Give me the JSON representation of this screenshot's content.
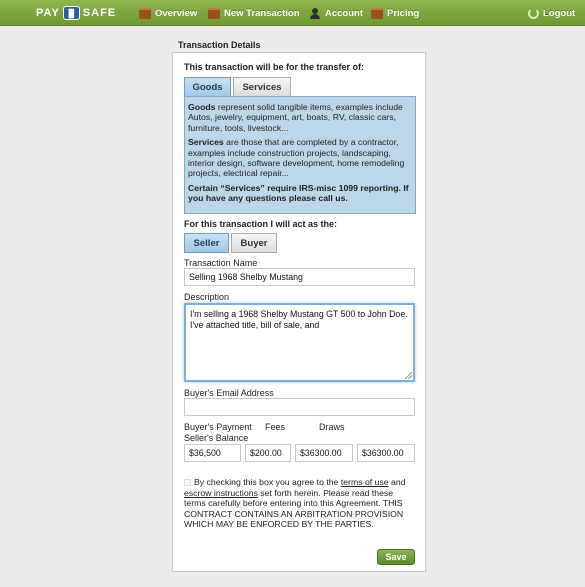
{
  "nav": {
    "logo_left": "PAY",
    "logo_mark": "▐▌",
    "logo_right": "SAFE",
    "items": [
      {
        "label": "Overview"
      },
      {
        "label": "New Transaction"
      },
      {
        "label": "Account"
      },
      {
        "label": "Pricing"
      }
    ],
    "logout": "Logout"
  },
  "form": {
    "section_title": "Transaction Details",
    "transfer_prompt": "This transaction will be for the transfer of:",
    "transfer_options": [
      "Goods",
      "Services"
    ],
    "transfer_selected": "Goods",
    "info": {
      "goods_term": "Goods",
      "goods_text": " represent solid tangible items, examples include Autos, jewelry, equipment, art, boats, RV, classic cars, furniture, tools, livestock...",
      "services_term": "Services",
      "services_text": " are those that are completed by a contractor, examples include construction projects, landscaping, interior design, software development, home remodeling projects, electrical repair...",
      "note": "Certain “Services” require IRS-misc 1099 reporting. If you have any questions please call us."
    },
    "role_prompt": "For this transaction I will act as the:",
    "role_options": [
      "Seller",
      "Buyer"
    ],
    "role_selected": "Seller",
    "name_label": "Transaction Name",
    "name_value": "Selling 1968 Shelby Mustang",
    "description_label": "Description",
    "description_value": "I'm selling a 1968 Shelby Mustang GT 500 to John Doe. I've attached title, bill of sale, and",
    "email_label": "Buyer's Email Address",
    "email_value": "",
    "payment_label": "Buyer's Payment",
    "fees_label": "Fees",
    "draws_label": "Draws",
    "balance_label": "Seller's Balance",
    "payment_value": "$36,500",
    "fees_value": "$200.00",
    "draws_value": "$36300.00",
    "balance_value": "$36300.00",
    "terms": {
      "pre": "By checking this box you agree to the ",
      "link1": "terms of use",
      "mid": " and ",
      "link2": "escrow instructions",
      "post": " set forth herein. Please read these terms carefully before entering into this Agreement. THIS CONTRACT CONTAINS AN ARBITRATION PROVISION WHICH MAY BE ENFORCED BY THE PARTIES."
    },
    "save_label": "Save"
  },
  "colors": {
    "nav_green": "#7aa53d",
    "selected_blue": "#a9cfe9",
    "info_blue": "#bcd7ea",
    "save_green": "#6e9a38"
  }
}
